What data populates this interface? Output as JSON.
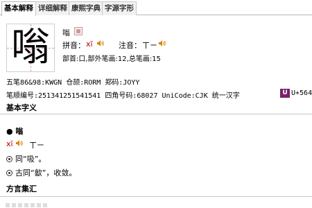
{
  "tabs": [
    {
      "label": "基本解释",
      "active": true
    },
    {
      "label": "详细解释",
      "active": false
    },
    {
      "label": "康熙字典",
      "active": false
    },
    {
      "label": "字源字形",
      "active": false
    }
  ],
  "character": {
    "glyph": "嗡",
    "small": "嗡",
    "pinyin_label": "拼音：",
    "pinyin": "xī",
    "zhuyin_label": "注音：",
    "zhuyin": "ㄒㄧ",
    "radical_line": "部首:口,部外笔画:12,总笔画:15"
  },
  "codes": {
    "line1": "五笔86&98:KWGN    仓颉:RORM    郑码:JOYY",
    "line2": "笔顺编号:251341251541541   四角号码:68027   UniCode:CJK 统一汉字",
    "unicode_icon": "U",
    "unicode_val": "U+564"
  },
  "sections": {
    "basic": "基本字义",
    "dialect": "方言集汇"
  },
  "entry": {
    "bullet_char": "● 嗡",
    "pinyin": "xī",
    "zhuyin": "ㄒㄧ",
    "def1": "同“吸”。",
    "def2": "古同“歙”，收敛。"
  },
  "colors": {
    "pinyin": "#b00000",
    "tab_border": "#b9b9b9",
    "unicode_icon_bg": "#7a1f6b"
  }
}
